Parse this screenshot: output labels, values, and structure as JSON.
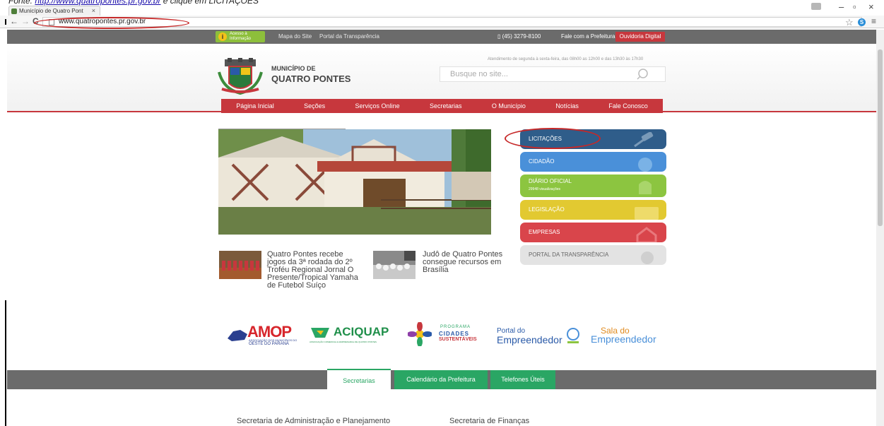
{
  "doc": {
    "line_text": "Fonte: ",
    "line_link": "http://www.quatropontes.pr.gov.br",
    "line_rest": " e clique em LICITAÇÕES"
  },
  "browser": {
    "tab_title": "Município de Quatro Pont",
    "tab_close": "×",
    "url": "www.quatropontes.pr.gov.br",
    "back": "←",
    "forward": "→",
    "reload": "C",
    "star": "☆",
    "skype": "S",
    "menu": "≡",
    "minimize": "–",
    "maximize": "▫",
    "close": "×"
  },
  "site": {
    "acesso_line1": "Acesso à",
    "acesso_line2": "Informação",
    "acesso_icon": "i",
    "top_links": [
      "Mapa do Site",
      "Portal da Transparência"
    ],
    "phone": "(45) 3279-8100",
    "fale_prefeitura": "Fale com a Prefeitura",
    "ouvidoria": "Ouvidoria Digital",
    "municipio_label": "MUNICÍPIO DE",
    "municipio_name": "QUATRO PONTES",
    "horario": "Atendimento de segunda à sexta-feira, das 08h00 as 12h00 e das 13h30 às 17h30",
    "search_placeholder": "Busque no site...",
    "nav": [
      "Página Inicial",
      "Seções",
      "Serviços Online",
      "Secretarias",
      "O Município",
      "Notícias",
      "Fale Conosco"
    ]
  },
  "news": [
    {
      "title": "Quatro Pontes recebe jogos da 3ª rodada do 2º Troféu Regional Jornal O Presente/Tropical Yamaha de Futebol Suíço"
    },
    {
      "title": "Judô de Quatro Pontes consegue recursos em Brasília"
    }
  ],
  "services": [
    {
      "label": "LICITAÇÕES",
      "color": "#2f5d8a"
    },
    {
      "label": "CIDADÃO",
      "color": "#4a90d9"
    },
    {
      "label": "DIÁRIO OFICIAL",
      "sub": "29948 visualizações",
      "color": "#8cc540"
    },
    {
      "label": "LEGISLAÇÃO",
      "color": "#e2c931"
    },
    {
      "label": "EMPRESAS",
      "color": "#d9454b"
    },
    {
      "label": "PORTAL DA TRANSPARÊNCIA",
      "color": "#e3e3e3"
    }
  ],
  "logos": {
    "amop": "AMOP",
    "amop_sub1": "ASSOCIAÇÃO DOS MUNICÍPIOS DO",
    "amop_sub2": "OESTE DO PARANÁ",
    "aciquap": "ACIQUAP",
    "aciquap_sub": "ASSOCIAÇÃO COMERCIAL E EMPRESARIAL DE QUATRO PONTES",
    "programa1": "PROGRAMA",
    "programa2": "CIDADES",
    "programa3": "SUSTENTÁVEIS",
    "portal1": "Portal do",
    "portal2": "Empreendedor",
    "sala1": "Sala do",
    "sala2": "Empreendedor"
  },
  "footer_tabs": [
    "Secretarias",
    "Calendário da Prefeitura",
    "Telefones Úteis"
  ],
  "secretarias": [
    "Secretaria de Administração e Planejamento",
    "Secretaria de Finanças"
  ],
  "colors": {
    "red": "#c7373d",
    "green": "#2aa664",
    "gray": "#6b6b6b"
  }
}
